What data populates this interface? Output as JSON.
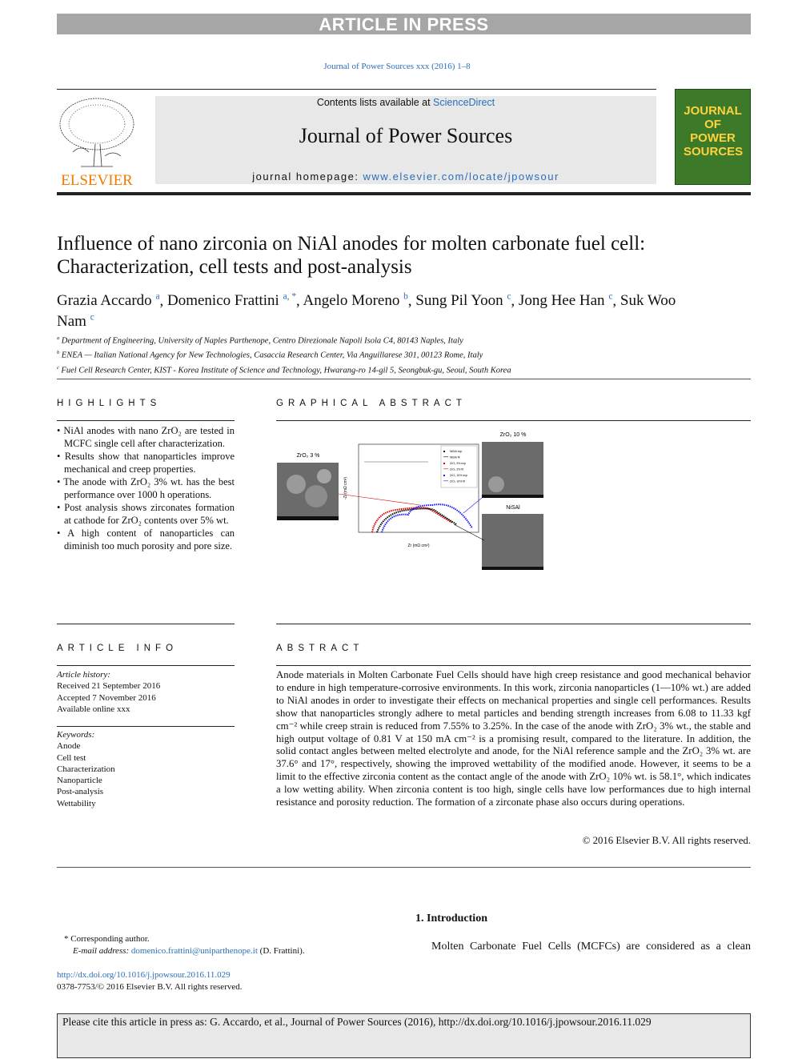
{
  "banner": "ARTICLE IN PRESS",
  "journal_ref": "Journal of Power Sources xxx (2016) 1–8",
  "masthead": {
    "contents_prefix": "Contents lists available at ",
    "sciencedirect": "ScienceDirect",
    "journal_name": "Journal of Power Sources",
    "homepage_prefix": "journal homepage: ",
    "homepage_url": "www.elsevier.com/locate/jpowsour",
    "publisher": "ELSEVIER",
    "cover_text": "JOURNAL OF POWER SOURCES"
  },
  "article": {
    "title": "Influence of nano zirconia on NiAl anodes for molten carbonate fuel cell: Characterization, cell tests and post-analysis",
    "authors": [
      {
        "name": "Grazia Accardo",
        "sup": "a"
      },
      {
        "name": "Domenico Frattini",
        "sup": "a, *"
      },
      {
        "name": "Angelo Moreno",
        "sup": "b"
      },
      {
        "name": "Sung Pil Yoon",
        "sup": "c"
      },
      {
        "name": "Jong Hee Han",
        "sup": "c"
      },
      {
        "name": "Suk Woo Nam",
        "sup": "c"
      }
    ],
    "affiliations": [
      {
        "sup": "a",
        "text": "Department of Engineering, University of Naples Parthenope, Centro Direzionale Napoli Isola C4, 80143 Naples, Italy"
      },
      {
        "sup": "b",
        "text": "ENEA — Italian National Agency for New Technologies, Casaccia Research Center, Via Anguillarese 301, 00123 Rome, Italy"
      },
      {
        "sup": "c",
        "text": "Fuel Cell Research Center, KIST - Korea Institute of Science and Technology, Hwarang-ro 14-gil 5, Seongbuk-gu, Seoul, South Korea"
      }
    ]
  },
  "highlights": {
    "heading": "HIGHLIGHTS",
    "items": [
      "NiAl anodes with nano ZrO₂ are tested in MCFC single cell after characterization.",
      "Results show that nanoparticles improve mechanical and creep properties.",
      "The anode with ZrO₂ 3% wt. has the best performance over 1000 h operations.",
      "Post analysis shows zirconates formation at cathode for ZrO₂ contents over 5% wt.",
      "A high content of nanoparticles can diminish too much porosity and pore size."
    ]
  },
  "graphical_abstract": {
    "heading": "GRAPHICAL ABSTRACT",
    "label_left": "ZrO₂ 3 %",
    "label_right_top": "ZrO₂ 10 %",
    "label_right_bottom": "NiSAl",
    "xlabel": "Zr (mΩ cm²)",
    "ylabel": "-Zi (mΩ cm²)",
    "legend": [
      "NiSAl exp",
      "NiSAl fit",
      "ZrO₂ 3% exp",
      "ZrO₂ 3% fit",
      "ZrO₂ 10% exp",
      "ZrO₂ 10% fit"
    ],
    "colors": {
      "nisal": "#000000",
      "zro2_3": "#e00000",
      "zro2_10": "#1a1aff"
    }
  },
  "article_info": {
    "heading": "ARTICLE INFO",
    "history_label": "Article history:",
    "history": [
      "Received 21 September 2016",
      "Accepted 7 November 2016",
      "Available online xxx"
    ],
    "keywords_label": "Keywords:",
    "keywords": [
      "Anode",
      "Cell test",
      "Characterization",
      "Nanoparticle",
      "Post-analysis",
      "Wettability"
    ]
  },
  "abstract": {
    "heading": "ABSTRACT",
    "text": "Anode materials in Molten Carbonate Fuel Cells should have high creep resistance and good mechanical behavior to endure in high temperature-corrosive environments. In this work, zirconia nanoparticles (1—10% wt.) are added to NiAl anodes in order to investigate their effects on mechanical properties and single cell performances. Results show that nanoparticles strongly adhere to metal particles and bending strength increases from 6.08 to 11.33 kgf cm⁻² while creep strain is reduced from 7.55% to 3.25%. In the case of the anode with ZrO₂ 3% wt., the stable and high output voltage of 0.81 V at 150 mA cm⁻² is a promising result, compared to the literature. In addition, the solid contact angles between melted electrolyte and anode, for the NiAl reference sample and the ZrO₂ 3% wt. are 37.6° and 17°, respectively, showing the improved wettability of the modified anode. However, it seems to be a limit to the effective zirconia content as the contact angle of the anode with ZrO₂ 10% wt. is 58.1°, which indicates a low wetting ability. When zirconia content is too high, single cells have low performances due to high internal resistance and porosity reduction. The formation of a zirconate phase also occurs during operations.",
    "copyright": "© 2016 Elsevier B.V. All rights reserved."
  },
  "introduction": {
    "heading": "1.  Introduction",
    "first_line": "Molten Carbonate Fuel Cells (MCFCs) are considered as a clean"
  },
  "footnote": {
    "corresponding": "* Corresponding author.",
    "email_label": "E-mail address: ",
    "email": "domenico.frattini@uniparthenope.it",
    "email_suffix": " (D. Frattini).",
    "doi": "http://dx.doi.org/10.1016/j.jpowsour.2016.11.029",
    "issn": "0378-7753/© 2016 Elsevier B.V. All rights reserved."
  },
  "citation": "Please cite this article in press as: G. Accardo, et al., Journal of Power Sources (2016), http://dx.doi.org/10.1016/j.jpowsour.2016.11.029"
}
